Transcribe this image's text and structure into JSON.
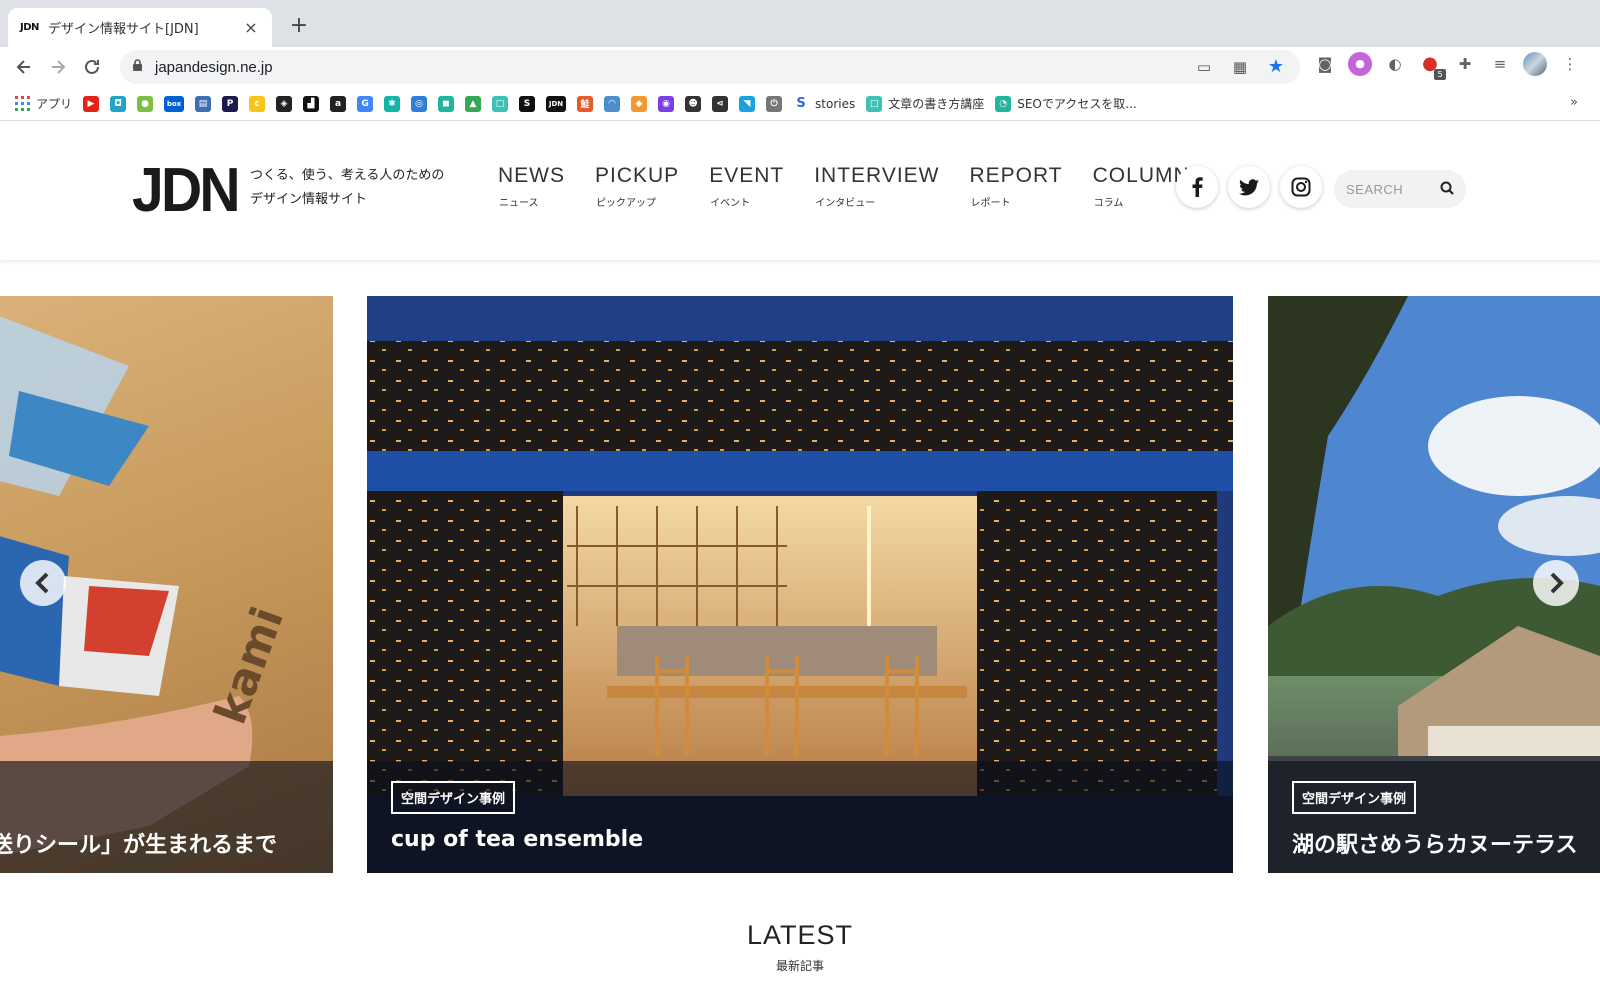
{
  "browser": {
    "tab_favicon": "JDN",
    "tab_title": "デザイン情報サイト[JDN]",
    "tab_close": "×",
    "new_tab": "+",
    "url": "japandesign.ne.jp",
    "extension_badge": "5"
  },
  "bookmarks": {
    "apps_label": "アプリ",
    "items": [
      {
        "icon": "youtube-icon",
        "color": "#e62117",
        "glyph": "▶"
      },
      {
        "icon": "contacts-icon",
        "color": "#1fa3c8",
        "glyph": "◘"
      },
      {
        "icon": "leaf-icon",
        "color": "#7bc043",
        "glyph": "●"
      },
      {
        "icon": "box-icon",
        "color": "#0061d5",
        "glyph": "box"
      },
      {
        "icon": "table-icon",
        "color": "#3b6fb6",
        "glyph": "▤"
      },
      {
        "icon": "p-app-icon",
        "color": "#1b1b4b",
        "glyph": "P"
      },
      {
        "icon": "coin-icon",
        "color": "#f5c518",
        "glyph": "c"
      },
      {
        "icon": "cube-icon",
        "color": "#222222",
        "glyph": "◈"
      },
      {
        "icon": "unsplash-icon",
        "color": "#111111",
        "glyph": "▟"
      },
      {
        "icon": "amazon-icon",
        "color": "#222222",
        "glyph": "a"
      },
      {
        "icon": "google-icon",
        "color": "#4285f4",
        "glyph": "G"
      },
      {
        "icon": "asterisk-icon",
        "color": "#15b3a8",
        "glyph": "✱"
      },
      {
        "icon": "nib-icon",
        "color": "#2f7fd8",
        "glyph": "◎"
      },
      {
        "icon": "message-icon",
        "color": "#20b59c",
        "glyph": "◼"
      },
      {
        "icon": "drive-icon",
        "color": "#34a853",
        "glyph": "▲"
      },
      {
        "icon": "square-app-icon",
        "color": "#3dc2b5",
        "glyph": "□"
      },
      {
        "icon": "s-app-icon",
        "color": "#111111",
        "glyph": "S"
      },
      {
        "icon": "jdn-icon",
        "color": "#111111",
        "glyph": "JDN"
      },
      {
        "icon": "kanji-app-icon",
        "color": "#e55b2a",
        "glyph": "鮭"
      },
      {
        "icon": "bird-icon",
        "color": "#4c8ec9",
        "glyph": "◠"
      },
      {
        "icon": "package-icon",
        "color": "#f29a2e",
        "glyph": "◆"
      },
      {
        "icon": "circle-app-icon",
        "color": "#7b3fe4",
        "glyph": "◉"
      },
      {
        "icon": "panda-icon",
        "color": "#333333",
        "glyph": "☻"
      },
      {
        "icon": "feather-icon",
        "color": "#333333",
        "glyph": "⋖"
      },
      {
        "icon": "flag-icon",
        "color": "#1aa0e0",
        "glyph": "◥"
      },
      {
        "icon": "power-icon",
        "color": "#777777",
        "glyph": "⏻"
      }
    ],
    "stories_label": "stories",
    "bookmark_2_label": "文章の書き方講座",
    "bookmark_3_label": "SEOでアクセスを取...",
    "more": "»"
  },
  "header": {
    "logo": "JDN",
    "tagline_line1": "つくる、使う、考える人のための",
    "tagline_line2": "デザイン情報サイト",
    "nav": [
      {
        "en": "NEWS",
        "ja": "ニュース"
      },
      {
        "en": "PICKUP",
        "ja": "ピックアップ"
      },
      {
        "en": "EVENT",
        "ja": "イベント"
      },
      {
        "en": "INTERVIEW",
        "ja": "インタビュー"
      },
      {
        "en": "REPORT",
        "ja": "レポート"
      },
      {
        "en": "COLUMN",
        "ja": "コラム"
      }
    ],
    "search_placeholder": "SEARCH"
  },
  "carousel": {
    "slides": [
      {
        "title": "送りシール」が生まれるまで"
      },
      {
        "tag": "空間デザイン事例",
        "title": "cup of tea ensemble"
      },
      {
        "tag": "空間デザイン事例",
        "title": "湖の駅さめうらカヌーテラス"
      }
    ]
  },
  "latest": {
    "title": "LATEST",
    "subtitle": "最新記事"
  }
}
